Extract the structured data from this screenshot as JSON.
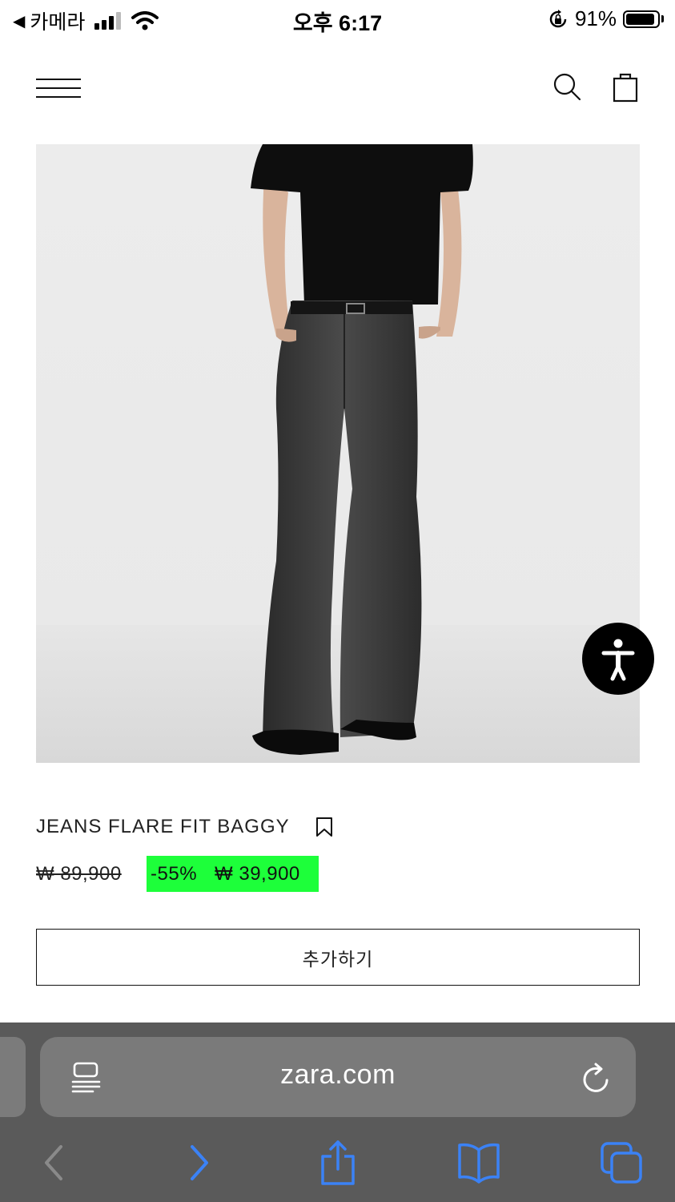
{
  "status_bar": {
    "back_arrow": "◀",
    "back_app": "카메라",
    "time": "오후 6:17",
    "battery_percent": "91%",
    "battery_level": 0.91,
    "icons": [
      "signal-icon",
      "wifi-icon",
      "rotation-lock-icon",
      "battery-icon"
    ]
  },
  "header": {
    "icons": [
      "menu-icon",
      "search-icon",
      "shopping-bag-icon"
    ]
  },
  "product": {
    "image": "model-wearing-black-tee-and-grey-flare-jeans",
    "name": "JEANS FLARE FIT BAGGY",
    "old_price": "₩ 89,900",
    "discount": "-55%",
    "sale_price": "₩ 39,900",
    "add_button_label": "추가하기"
  },
  "accessibility_button": {
    "icon": "accessibility-icon"
  },
  "browser": {
    "url": "zara.com",
    "icons": [
      "reader-icon",
      "reload-icon",
      "back-icon",
      "forward-icon",
      "share-icon",
      "bookmarks-icon",
      "tabs-icon"
    ]
  },
  "colors": {
    "sale_highlight": "#1dff3a",
    "browser_bar": "#5a5a5a",
    "url_bar": "#7a7a7a",
    "ios_blue": "#3b82f6"
  }
}
